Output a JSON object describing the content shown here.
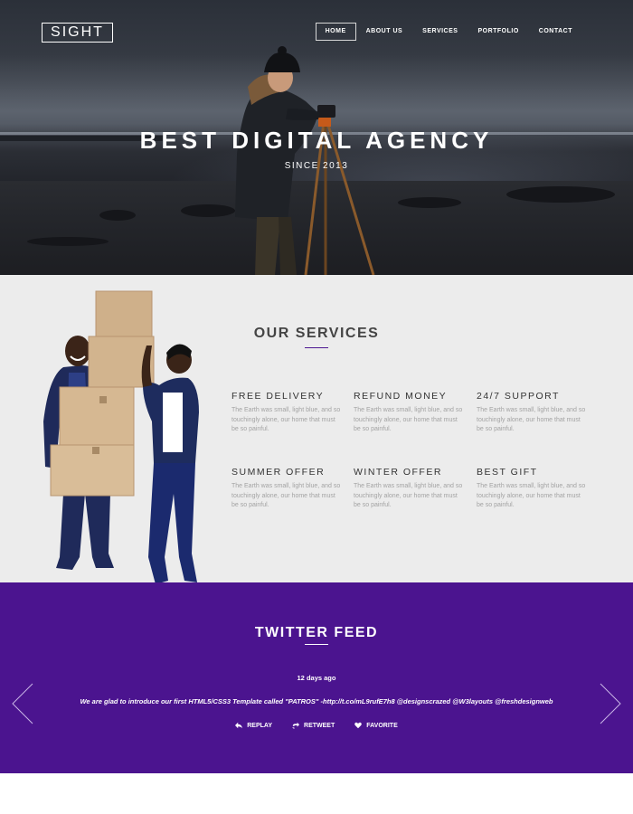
{
  "header": {
    "logo": "SIGHT",
    "nav": [
      {
        "label": "HOME",
        "active": true
      },
      {
        "label": "ABOUT US",
        "active": false
      },
      {
        "label": "SERVICES",
        "active": false
      },
      {
        "label": "PORTFOLIO",
        "active": false
      },
      {
        "label": "CONTACT",
        "active": false
      }
    ]
  },
  "hero": {
    "title": "BEST DIGITAL AGENCY",
    "subtitle": "SINCE 2013"
  },
  "services": {
    "heading": "OUR SERVICES",
    "items": [
      {
        "title": "FREE DELIVERY",
        "desc": "The Earth was small, light blue, and so touchingly alone, our home that must be so painful."
      },
      {
        "title": "REFUND MONEY",
        "desc": "The Earth was small, light blue, and so touchingly alone, our home that must be so painful."
      },
      {
        "title": "24/7 SUPPORT",
        "desc": "The Earth was small, light blue, and so touchingly alone, our home that must be so painful."
      },
      {
        "title": "SUMMER OFFER",
        "desc": "The Earth was small, light blue, and so touchingly alone, our home that must be so painful."
      },
      {
        "title": "WINTER OFFER",
        "desc": "The Earth was small, light blue, and so touchingly alone, our home that must be so painful."
      },
      {
        "title": "BEST GIFT",
        "desc": "The Earth was small, light blue, and so touchingly alone, our home that must be so painful."
      }
    ]
  },
  "twitter": {
    "heading": "TWITTER FEED",
    "time": "12 days ago",
    "tweet": "We are glad to introduce our first HTML5/CSS3 Template called \"PATROS\" -http://t.co/mL9rufE7h8 @designscrazed @W3layouts @freshdesignweb",
    "actions": {
      "reply": "REPLAY",
      "retweet": "RETWEET",
      "favorite": "FAVORITE"
    }
  },
  "colors": {
    "accent_purple": "#4b148f",
    "services_bg": "#ececec",
    "hero_text": "#ffffff"
  },
  "icons": [
    "reply-icon",
    "retweet-icon",
    "heart-icon",
    "chevron-left-icon",
    "chevron-right-icon"
  ]
}
